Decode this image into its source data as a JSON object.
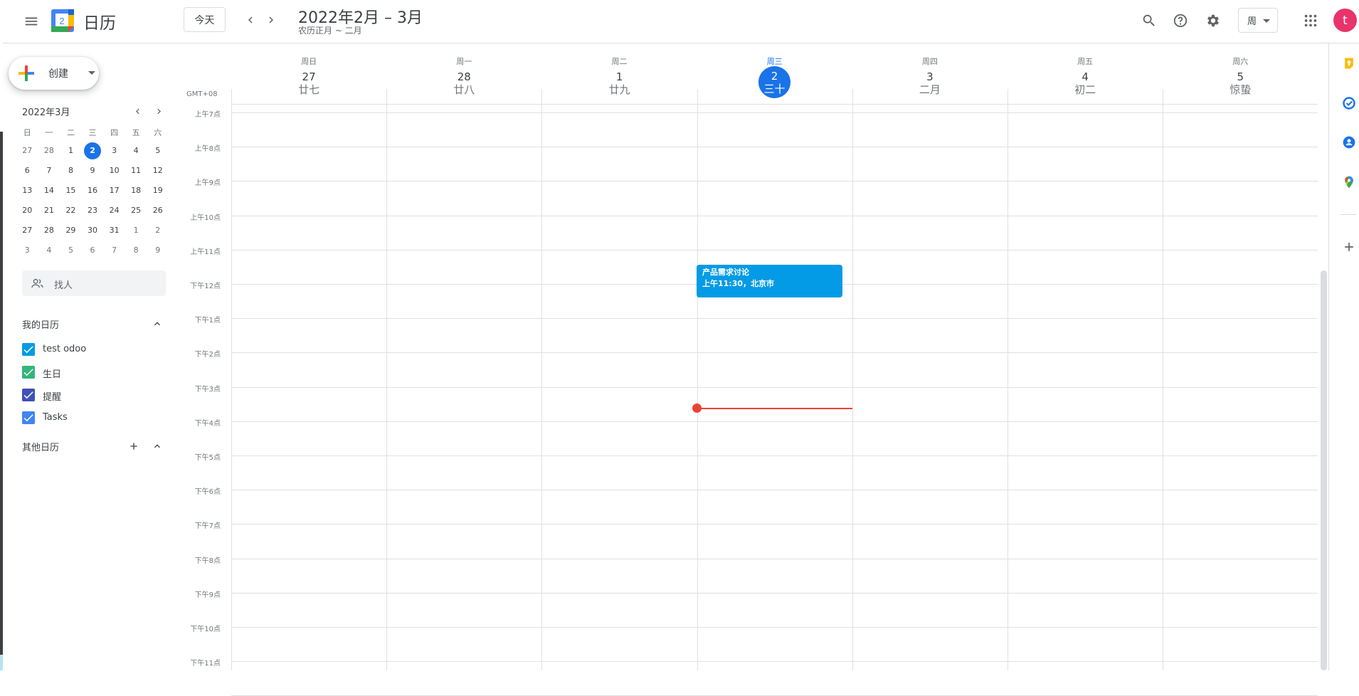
{
  "app": {
    "title": "日历"
  },
  "logo": {
    "day": "2"
  },
  "header": {
    "today_label": "今天",
    "date_range": "2022年2月 – 3月",
    "lunar_range": "农历正月 ~ 二月",
    "view_label": "周",
    "avatar_letter": "t",
    "icons": [
      "menu-icon",
      "prev-icon",
      "next-icon",
      "search-icon",
      "help-icon",
      "settings-icon",
      "apps-icon"
    ]
  },
  "sidebar": {
    "create_label": "创建",
    "mini_calendar": {
      "title": "2022年3月",
      "weekdays": [
        "日",
        "一",
        "二",
        "三",
        "四",
        "五",
        "六"
      ],
      "weeks": [
        [
          "27",
          "28",
          "1",
          "2",
          "3",
          "4",
          "5"
        ],
        [
          "6",
          "7",
          "8",
          "9",
          "10",
          "11",
          "12"
        ],
        [
          "13",
          "14",
          "15",
          "16",
          "17",
          "18",
          "19"
        ],
        [
          "20",
          "21",
          "22",
          "23",
          "24",
          "25",
          "26"
        ],
        [
          "27",
          "28",
          "29",
          "30",
          "31",
          "1",
          "2"
        ],
        [
          "3",
          "4",
          "5",
          "6",
          "7",
          "8",
          "9"
        ]
      ]
    },
    "search_people": "找人",
    "my_calendars": {
      "title": "我的日历",
      "items": [
        {
          "label": "test odoo",
          "color": "#039be5"
        },
        {
          "label": "生日",
          "color": "#33b679"
        },
        {
          "label": "提醒",
          "color": "#3f51b5"
        },
        {
          "label": "Tasks",
          "color": "#4285f4"
        }
      ]
    },
    "other_calendars": {
      "title": "其他日历"
    }
  },
  "week": {
    "timezone": "GMT+08",
    "days": [
      {
        "dow": "周日",
        "num": "27",
        "lunar": "廿七"
      },
      {
        "dow": "周一",
        "num": "28",
        "lunar": "廿八"
      },
      {
        "dow": "周二",
        "num": "1",
        "lunar": "廿九"
      },
      {
        "dow": "周三",
        "num": "2",
        "lunar": "三十",
        "today": true
      },
      {
        "dow": "周四",
        "num": "3",
        "lunar": "二月"
      },
      {
        "dow": "周五",
        "num": "4",
        "lunar": "初二"
      },
      {
        "dow": "周六",
        "num": "5",
        "lunar": "惊蛰"
      }
    ],
    "hours": [
      "上午7点",
      "上午8点",
      "上午9点",
      "上午10点",
      "上午11点",
      "下午12点",
      "下午1点",
      "下午2点",
      "下午3点",
      "下午4点",
      "下午5点",
      "下午6点",
      "下午7点",
      "下午8点",
      "下午9点",
      "下午10点",
      "下午11点"
    ],
    "event": {
      "title": "产品需求讨论",
      "time": "上午11:30，北京市",
      "color": "#039be5"
    },
    "accent_color": "#1a73e8",
    "now_color": "#ea4335"
  },
  "side_panel": {
    "icons": [
      "keep-icon",
      "tasks-icon",
      "contacts-icon",
      "maps-icon",
      "add-icon"
    ]
  }
}
